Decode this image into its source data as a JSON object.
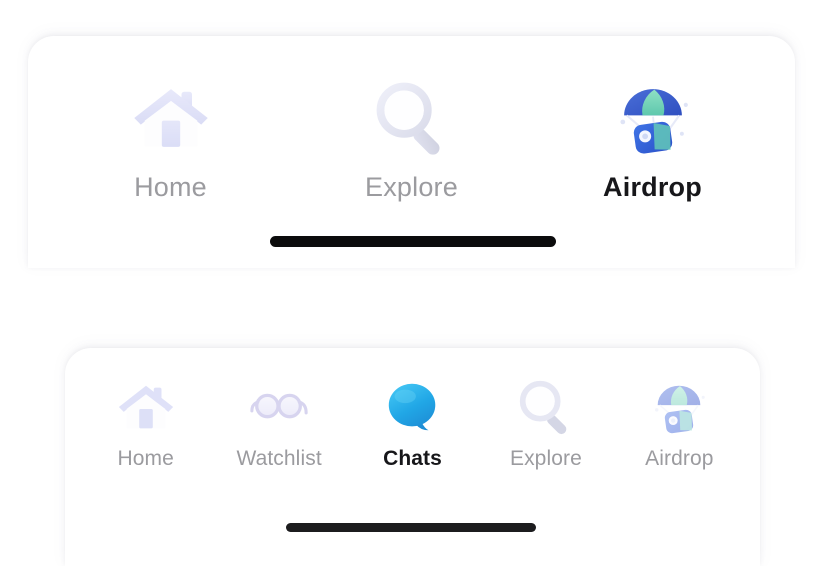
{
  "screen": {
    "background_color": "#ffffff",
    "description": "Two stacked mobile bottom-navigation bar variants"
  },
  "colors": {
    "label_inactive": "#9b9b9f",
    "label_active": "#17171a",
    "card_background": "#ffffff",
    "home_indicator": "#0b0b0c",
    "icon_lavender": "#b9bdf0",
    "icon_blue": "#2f7fe0",
    "icon_teal": "#7fd6c0",
    "chat_bubble_blue": "#23a6e8"
  },
  "top_nav": {
    "name": "top-navigation-bar",
    "active_index": 2,
    "items": [
      {
        "label": "Home",
        "icon": "house-icon",
        "active": false
      },
      {
        "label": "Explore",
        "icon": "magnifying-glass-icon",
        "active": false
      },
      {
        "label": "Airdrop",
        "icon": "parachute-icon",
        "active": true
      }
    ],
    "home_indicator": {
      "name": "home-indicator"
    }
  },
  "bottom_nav": {
    "name": "bottom-navigation-bar",
    "active_index": 2,
    "items": [
      {
        "label": "Home",
        "icon": "house-icon",
        "active": false
      },
      {
        "label": "Watchlist",
        "icon": "glasses-icon",
        "active": false
      },
      {
        "label": "Chats",
        "icon": "speech-bubble-icon",
        "active": true
      },
      {
        "label": "Explore",
        "icon": "magnifying-glass-icon",
        "active": false
      },
      {
        "label": "Airdrop",
        "icon": "parachute-icon",
        "active": false
      }
    ],
    "home_indicator": {
      "name": "home-indicator"
    }
  }
}
